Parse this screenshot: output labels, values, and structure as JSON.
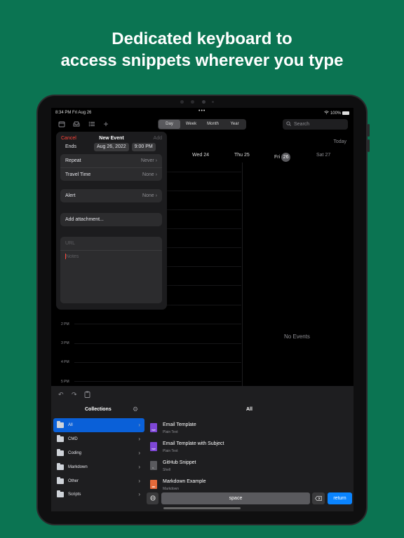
{
  "headline": {
    "line1": "Dedicated keyboard to",
    "line2": "access snippets wherever you type"
  },
  "status": {
    "time": "8:34 PM",
    "date": "Fri Aug 26",
    "dots": "•••",
    "battery": "100%"
  },
  "view_switcher": {
    "day": "Day",
    "week": "Week",
    "month": "Month",
    "year": "Year",
    "selected": "Day"
  },
  "search": {
    "placeholder": "Search"
  },
  "calendar": {
    "today_button": "Today",
    "days": [
      {
        "label": "Wed 24"
      },
      {
        "label": "Thu 25"
      },
      {
        "prefix": "Fri",
        "num": "26"
      },
      {
        "label": "Sat 27"
      }
    ],
    "times": [
      "2 PM",
      "3 PM",
      "4 PM",
      "5 PM"
    ],
    "empty_text": "No Events"
  },
  "new_event": {
    "cancel": "Cancel",
    "title": "New Event",
    "add": "Add",
    "ends_label": "Ends",
    "ends_date": "Aug 26, 2022",
    "ends_time": "9:00 PM",
    "repeat_label": "Repeat",
    "repeat_value": "Never",
    "travel_label": "Travel Time",
    "travel_value": "None",
    "alert_label": "Alert",
    "alert_value": "None",
    "attachment": "Add attachment...",
    "url_placeholder": "URL",
    "notes_placeholder": "Notes"
  },
  "keyboard": {
    "collections_title": "Collections",
    "list_title": "All",
    "collections": [
      {
        "label": "All",
        "active": true
      },
      {
        "label": "CMD"
      },
      {
        "label": "Coding"
      },
      {
        "label": "Markdown"
      },
      {
        "label": "Other"
      },
      {
        "label": "Scripts"
      }
    ],
    "snippets": [
      {
        "name": "Email Template",
        "kind": "Plain Text",
        "badge": "TXT",
        "color": "#7e47d6"
      },
      {
        "name": "Email Template with Subject",
        "kind": "Plain Text",
        "badge": "TXT",
        "color": "#7e47d6"
      },
      {
        "name": "GitHub Snippet",
        "kind": "Shell",
        "badge": ">_",
        "color": "#5a5a5e"
      },
      {
        "name": "Markdown Example",
        "kind": "Markdown",
        "badge": "MD",
        "color": "#e56a3a"
      }
    ],
    "space": "space",
    "return": "return"
  },
  "colors": {
    "background": "#0b7452",
    "accent": "#0a60d8",
    "destructive": "#ff453a"
  }
}
